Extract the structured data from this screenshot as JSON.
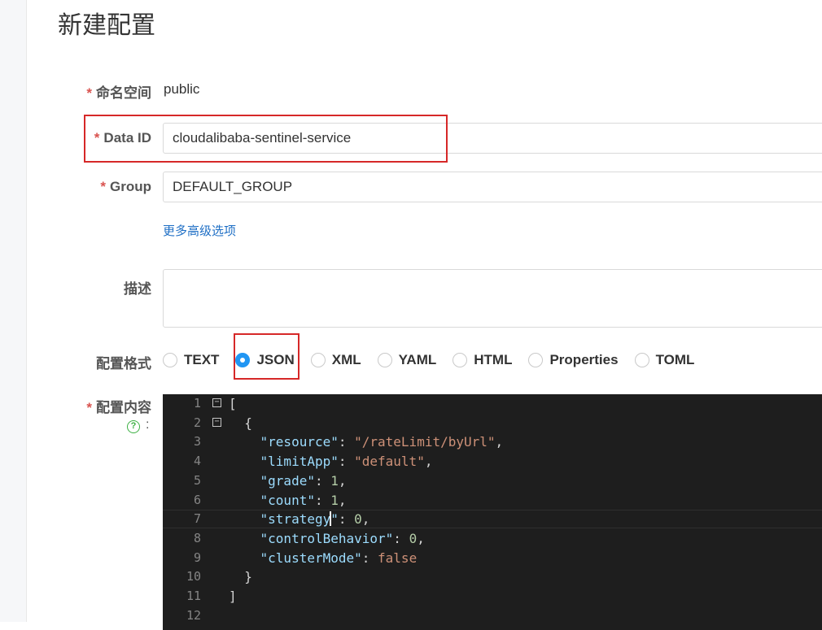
{
  "page": {
    "title": "新建配置"
  },
  "form": {
    "namespace": {
      "label": "命名空间",
      "value": "public"
    },
    "data_id": {
      "label": "Data ID",
      "value": "cloudalibaba-sentinel-service"
    },
    "group": {
      "label": "Group",
      "value": "DEFAULT_GROUP"
    },
    "more_options_link": "更多高级选项",
    "description": {
      "label": "描述",
      "value": ""
    },
    "format": {
      "label": "配置格式",
      "options": [
        "TEXT",
        "JSON",
        "XML",
        "YAML",
        "HTML",
        "Properties",
        "TOML"
      ],
      "selected": "JSON"
    },
    "content": {
      "label": "配置内容",
      "help_icon": "question-circle-icon",
      "colon": ":"
    },
    "required_mark": "*"
  },
  "editor": {
    "lines": [
      {
        "n": "1",
        "fold": "⊟"
      },
      {
        "n": "2",
        "fold": "⊟"
      },
      {
        "n": "3"
      },
      {
        "n": "4"
      },
      {
        "n": "5"
      },
      {
        "n": "6"
      },
      {
        "n": "7"
      },
      {
        "n": "8"
      },
      {
        "n": "9"
      },
      {
        "n": "10"
      },
      {
        "n": "11"
      },
      {
        "n": "12"
      }
    ],
    "code": {
      "l1": "[",
      "l2": "  {",
      "l3_key": "\"resource\"",
      "l3_val": "\"/rateLimit/byUrl\"",
      "l4_key": "\"limitApp\"",
      "l4_val": "\"default\"",
      "l5_key": "\"grade\"",
      "l5_val": "1",
      "l6_key": "\"count\"",
      "l6_val": "1",
      "l7_key_a": "\"strategy",
      "l7_key_b": "\"",
      "l7_val": "0",
      "l8_key": "\"controlBehavior\"",
      "l8_val": "0",
      "l9_key": "\"clusterMode\"",
      "l9_val": "false",
      "l10": "  }",
      "l11": "]"
    }
  },
  "colors": {
    "accent": "#2196f3",
    "required": "#d9534f",
    "highlight": "#d62828",
    "link": "#1f6fc5",
    "editor_bg": "#1e1e1e"
  }
}
